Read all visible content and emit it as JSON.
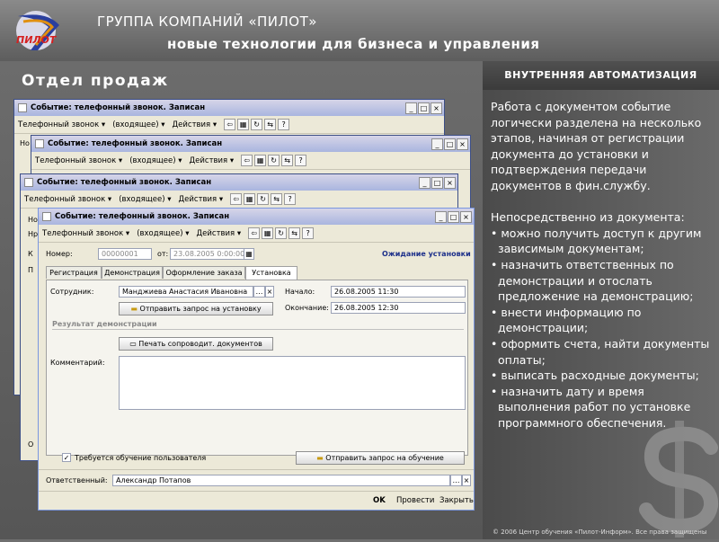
{
  "header": {
    "company": "ГРУППА КОМПАНИЙ «ПИЛОТ»",
    "tagline": "новые технологии для бизнеса и управления",
    "logo_text": "ПИЛОТ"
  },
  "section_title": "Отдел продаж",
  "right_panel": {
    "heading": "ВНУТРЕННЯЯ АВТОМАТИЗАЦИЯ",
    "text": "Работа с документом событие логически разделена на несколько этапов, начиная от регистрации документа до установки и подтверждения передачи документов в фин.службу.\n\nНепосредственно из документа:\n• можно получить доступ к другим\n  зависимым документам;\n• назначить ответственных по\n  демонстрации и отослать\n  предложение на демонстрацию;\n• внести информацию по\n  демонстрации;\n• оформить счета, найти документы\n  оплаты;\n• выписать расходные документы;\n• назначить дату и время\n  выполнения работ по установке\n  программного обеспечения.",
    "footer_note": "© 2006 Центр обучения «Пилот-Информ». Все права защищены"
  },
  "window": {
    "title": "Событие: телефонный звонок. Записан",
    "toolbar": {
      "type_menu": "Телефонный звонок",
      "direction_menu": "(входящее)",
      "actions_menu": "Действия"
    },
    "partial_labels": {
      "no": "Но",
      "nr": "Нр",
      "k": "К",
      "p": "П",
      "o": "О"
    },
    "number_label": "Номер:",
    "number_value": "00000001",
    "date_label": "от:",
    "date_value": "23.08.2005 0:00:00",
    "status": "Ожидание установки",
    "tabs": [
      "Регистрация",
      "Демонстрация",
      "Оформление заказа",
      "Установка"
    ],
    "employee_label": "Сотрудник:",
    "employee_value": "Манджиева Анастасия Ивановна",
    "start_label": "Начало:",
    "start_value": "26.08.2005 11:30",
    "end_label": "Окончание:",
    "end_value": "26.08.2005 12:30",
    "send_install_btn": "Отправить запрос на установку",
    "demo_result_heading": "Результат демонстрации",
    "print_btn": "Печать сопроводит. документов",
    "comment_label": "Комментарий:",
    "training_checkbox": "Требуется обучение пользователя",
    "send_training_btn": "Отправить запрос на обучение",
    "responsible_label": "Ответственный:",
    "responsible_value": "Александр Потапов",
    "ok_btn": "OK",
    "post_btn": "Провести",
    "close_btn": "Закрыть"
  },
  "colors": {
    "accent_blue": "#1f3f9e",
    "titlebar": "#a9b5df",
    "status_text": "#1c2f8a"
  }
}
